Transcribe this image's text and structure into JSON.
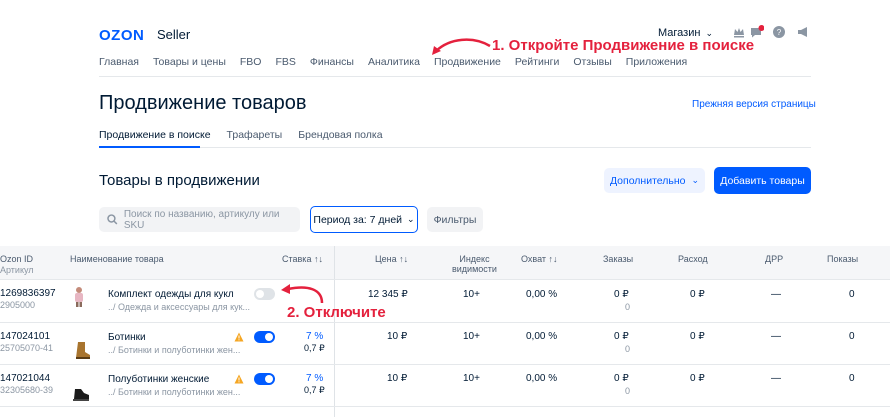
{
  "header": {
    "logo": "OZON",
    "logo_sub": "Seller",
    "store_label": "Магазин",
    "nav": [
      "Главная",
      "Товары и цены",
      "FBO",
      "FBS",
      "Финансы",
      "Аналитика",
      "Продвижение",
      "Рейтинги",
      "Отзывы",
      "Приложения"
    ]
  },
  "annotations": {
    "step1": "1. Откройте Продвижение в поиске",
    "step2": "2. Отключите"
  },
  "page": {
    "title": "Продвижение товаров",
    "prev_version_link": "Прежняя версия страницы",
    "tabs": [
      "Продвижение в поиске",
      "Трафареты",
      "Брендовая полка"
    ],
    "section_title": "Товары в продвижении",
    "more_button": "Дополнительно",
    "add_button": "Добавить товары",
    "search_placeholder": "Поиск по названию, артикулу или SKU",
    "period_label": "Период за: 7 дней",
    "filters_button": "Фильтры"
  },
  "table": {
    "headers": {
      "ozon_id": "Ozon ID",
      "article": "Артикул",
      "name": "Наименование товара",
      "bid": "Ставка",
      "price": "Цена",
      "visibility_1": "Индекс",
      "visibility_2": "видимости",
      "reach": "Охват",
      "orders": "Заказы",
      "expense": "Расход",
      "drr": "ДРР",
      "shows": "Показы"
    },
    "rows": [
      {
        "id": "1269836397",
        "article": "2905000",
        "name": "Комплект одежды для кукл",
        "category": "../ Одежда и аксессуары для кук...",
        "enabled": false,
        "bid_pct": "",
        "bid_rub": "",
        "price": "12 345 ₽",
        "visibility": "10+",
        "reach": "0,00 %",
        "orders": "0 ₽",
        "orders_sub": "0",
        "expense": "0 ₽",
        "drr": "—",
        "shows": "0",
        "warning": false
      },
      {
        "id": "147024101",
        "article": "25705070-41",
        "name": "Ботинки",
        "category": "../ Ботинки и полуботинки жен...",
        "enabled": true,
        "bid_pct": "7 %",
        "bid_rub": "0,7 ₽",
        "price": "10 ₽",
        "visibility": "10+",
        "reach": "0,00 %",
        "orders": "0 ₽",
        "orders_sub": "0",
        "expense": "0 ₽",
        "drr": "—",
        "shows": "0",
        "warning": true
      },
      {
        "id": "147021044",
        "article": "32305680-39",
        "name": "Полуботинки женские",
        "category": "../ Ботинки и полуботинки жен...",
        "enabled": true,
        "bid_pct": "7 %",
        "bid_rub": "0,7 ₽",
        "price": "10 ₽",
        "visibility": "10+",
        "reach": "0,00 %",
        "orders": "0 ₽",
        "orders_sub": "0",
        "expense": "0 ₽",
        "drr": "—",
        "shows": "0",
        "warning": true
      }
    ]
  },
  "colors": {
    "accent": "#005bff",
    "annotation": "#e4213d",
    "warning": "#f5a623"
  }
}
